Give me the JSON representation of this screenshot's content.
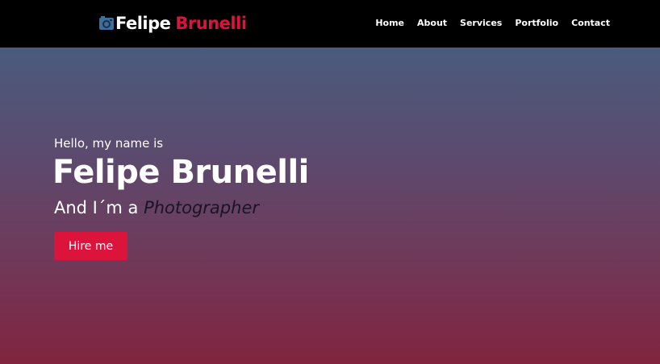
{
  "header": {
    "brand": {
      "icon": "camera-icon",
      "first_name": "Felipe",
      "last_name": "Brunelli"
    },
    "nav": [
      {
        "label": "Home"
      },
      {
        "label": "About"
      },
      {
        "label": "Services"
      },
      {
        "label": "Portfolio"
      },
      {
        "label": "Contact"
      }
    ]
  },
  "hero": {
    "greeting": "Hello, my name is",
    "name": "Felipe Brunelli",
    "tagline_prefix": "And I´m a",
    "role": "Photographer",
    "cta_label": "Hire me"
  },
  "colors": {
    "navbar_bg": "#000000",
    "accent": "#dc143c",
    "gradient_top": "#4a5b7d",
    "gradient_bottom": "#80243f"
  }
}
